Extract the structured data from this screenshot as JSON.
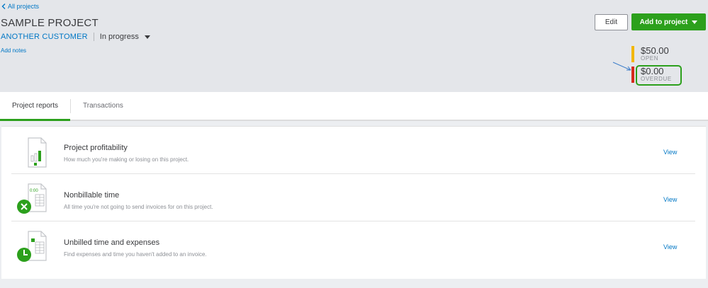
{
  "header": {
    "back_link": "All projects",
    "title": "SAMPLE PROJECT",
    "customer": "ANOTHER CUSTOMER",
    "status": "In progress",
    "add_notes": "Add notes",
    "edit_label": "Edit",
    "add_to_project_label": "Add to project"
  },
  "summary": {
    "open": {
      "amount": "$50.00",
      "label": "OPEN",
      "color": "#f2b705"
    },
    "overdue": {
      "amount": "$0.00",
      "label": "OVERDUE",
      "color": "#d52b1e"
    },
    "highlight_color": "#2ca01c"
  },
  "tabs": [
    {
      "label": "Project reports",
      "active": true
    },
    {
      "label": "Transactions",
      "active": false
    }
  ],
  "reports": [
    {
      "title": "Project profitability",
      "description": "How much you're making or losing on this project.",
      "action": "View",
      "icon": "profitability-chart-icon"
    },
    {
      "title": "Nonbillable time",
      "description": "All time you're not going to send invoices for on this project.",
      "action": "View",
      "icon": "nonbillable-time-icon"
    },
    {
      "title": "Unbilled time and expenses",
      "description": "Find expenses and time you haven't added to an invoice.",
      "action": "View",
      "icon": "unbilled-time-icon"
    }
  ],
  "nonbillable_icon_text": "0:00",
  "colors": {
    "accent": "#2ca01c",
    "link": "#0077c5"
  }
}
